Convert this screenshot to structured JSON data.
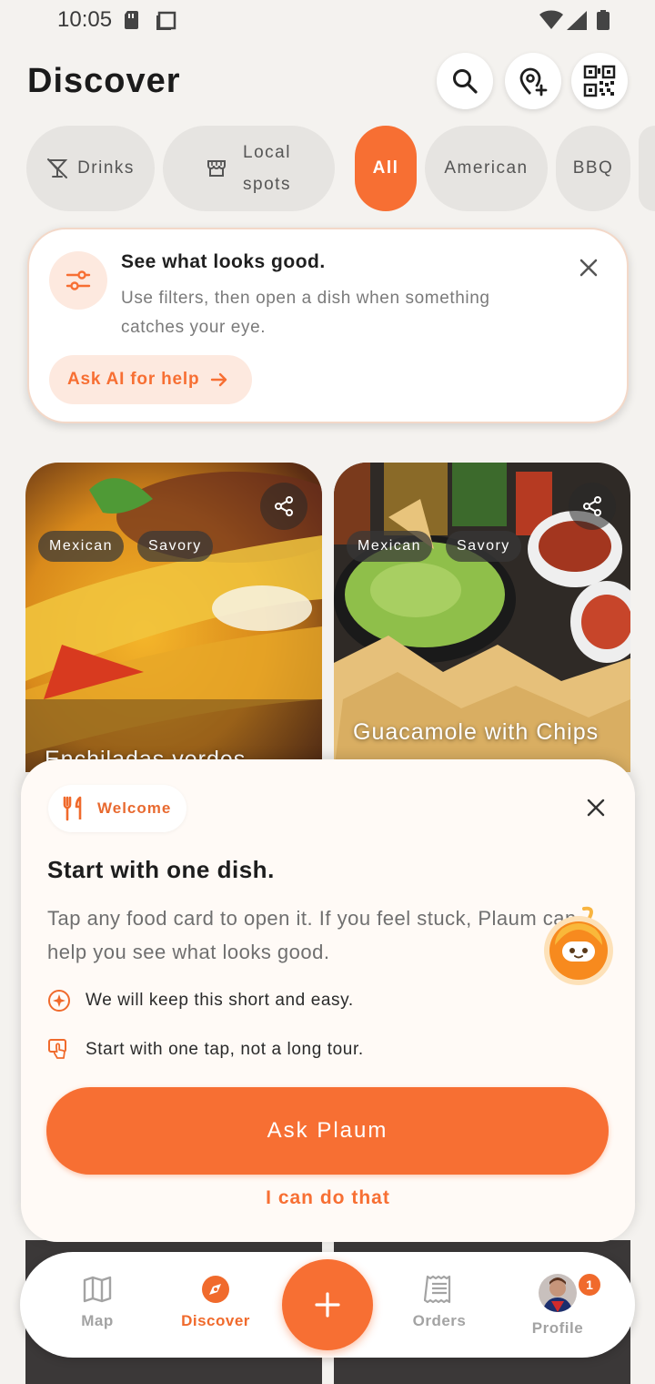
{
  "status_bar": {
    "time": "10:05"
  },
  "header": {
    "title": "Discover"
  },
  "icons": {
    "search": "search-icon",
    "location": "add-location-icon",
    "qr": "qr-code-icon"
  },
  "chips": [
    {
      "label": "Drinks",
      "icon": "drinks-icon"
    },
    {
      "label": "Local spots",
      "line1": "Local",
      "line2": "spots",
      "icon": "storefront-icon"
    },
    {
      "label": "All",
      "active": true
    },
    {
      "label": "American"
    },
    {
      "label": "BBQ"
    }
  ],
  "tip_card": {
    "title": "See what looks good.",
    "body": "Use filters, then open a dish when something catches your eye.",
    "action_label": "Ask AI for help"
  },
  "cards": [
    {
      "tags": [
        "Mexican",
        "Savory"
      ],
      "title": "Enchiladas verdes"
    },
    {
      "tags": [
        "Mexican",
        "Savory"
      ],
      "title": "Guacamole with Chips"
    }
  ],
  "onboarding": {
    "badge": "Welcome",
    "title": "Start with one dish.",
    "body": "Tap any food card to open it. If you feel stuck, Plaum can help you see what looks good.",
    "points": [
      "We will keep this short and easy.",
      "Start with one tap, not a long tour."
    ],
    "primary_label": "Ask Plaum",
    "secondary_label": "I can do that"
  },
  "nav": {
    "items": [
      {
        "label": "Map",
        "icon": "map-icon"
      },
      {
        "label": "Discover",
        "icon": "compass-icon",
        "active": true
      },
      {
        "label": "Orders",
        "icon": "receipt-icon"
      },
      {
        "label": "Profile",
        "icon": "avatar"
      }
    ],
    "badge_count": "1"
  },
  "colors": {
    "accent": "#f76f33",
    "background": "#f4f2ef",
    "chip_bg": "#e6e4e1"
  }
}
